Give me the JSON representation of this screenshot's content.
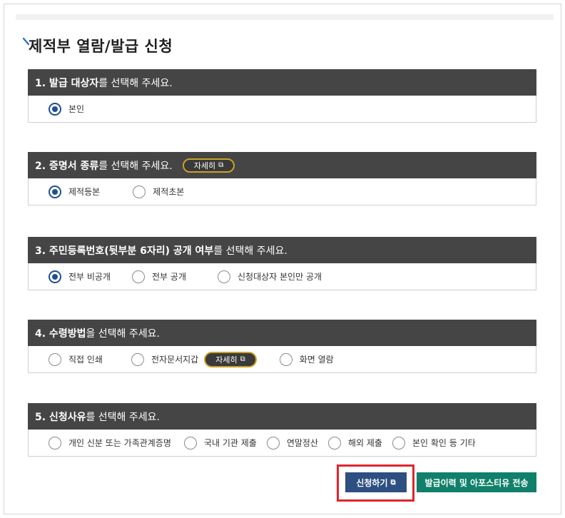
{
  "page": {
    "title": "제적부 열람/발급 신청"
  },
  "sections": [
    {
      "heading_bold": "1. 발급 대상자",
      "heading_rest": "를 선택해 주세요.",
      "options": [
        {
          "label": "본인",
          "selected": true
        }
      ]
    },
    {
      "heading_bold": "2. 증명서 종류",
      "heading_rest": "를 선택해 주세요.",
      "detail_label": "자세히",
      "options": [
        {
          "label": "제적등본",
          "selected": true
        },
        {
          "label": "제적초본",
          "selected": false
        }
      ]
    },
    {
      "heading_bold": "3. 주민등록번호(뒷부분 6자리) 공개 여부",
      "heading_rest": "를 선택해 주세요.",
      "options": [
        {
          "label": "전부 비공개",
          "selected": true
        },
        {
          "label": "전부 공개",
          "selected": false
        },
        {
          "label": "신청대상자 본인만 공개",
          "selected": false
        }
      ]
    },
    {
      "heading_bold": "4. 수령방법",
      "heading_rest": "을 선택해 주세요.",
      "detail_label": "자세히",
      "options": [
        {
          "label": "직접 인쇄",
          "selected": false
        },
        {
          "label": "전자문서지갑",
          "selected": false
        },
        {
          "label": "화면 열람",
          "selected": false
        }
      ]
    },
    {
      "heading_bold": "5. 신청사유",
      "heading_rest": "를 선택해 주세요.",
      "options": [
        {
          "label": "개인 신분 또는 가족관계증명",
          "selected": false
        },
        {
          "label": "국내 기관 제출",
          "selected": false
        },
        {
          "label": "연말정산",
          "selected": false
        },
        {
          "label": "해외 제출",
          "selected": false
        },
        {
          "label": "본인 확인 등 기타",
          "selected": false
        }
      ]
    }
  ],
  "actions": {
    "apply_label": "신청하기",
    "send_label": "발급이력 및 아포스티유 전송"
  },
  "colors": {
    "header_bg": "#454545",
    "radio_selected": "#1f4f95",
    "apply_bg": "#2e4f81",
    "send_bg": "#10806a",
    "highlight": "#e0242c"
  }
}
